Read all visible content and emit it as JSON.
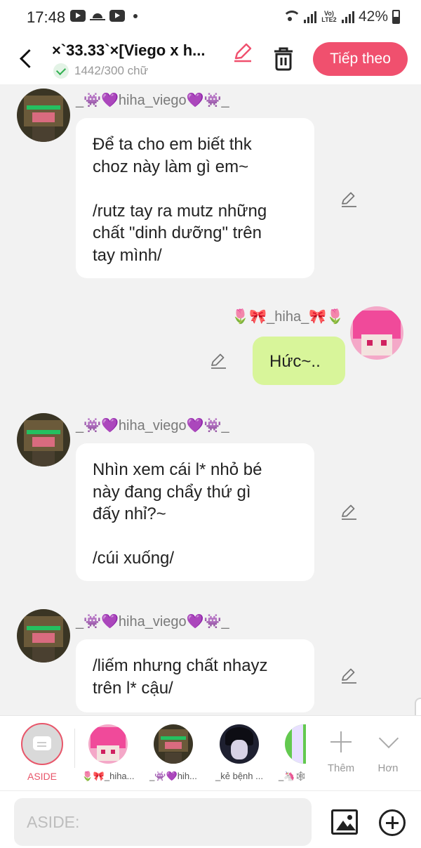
{
  "status_bar": {
    "time": "17:48",
    "network": "Vo) LTE2",
    "battery": "42%"
  },
  "header": {
    "title": "×`33.33`×[Viego x h...",
    "word_count": "1442/300 chữ",
    "next_label": "Tiếp theo",
    "accent_color": "#f0506e"
  },
  "messages": [
    {
      "sender": "_👾💜hiha_viego💜👾_",
      "side": "left",
      "text": "Để ta cho em biết thk\nchoz này làm gì em~\n\n/rutz tay ra mutz những\nchất \"dinh dưỡng\" trên\ntay mình/"
    },
    {
      "sender": "🌷🎀_hiha_🎀🌷",
      "side": "right",
      "text": "Hức~.."
    },
    {
      "sender": "_👾💜hiha_viego💜👾_",
      "side": "left",
      "text": "Nhìn xem cái l* nhỏ bé\nnày đang chẩy thứ gì\nđấy nhỉ?~\n\n/cúi xuống/"
    },
    {
      "sender": "_👾💜hiha_viego💜👾_",
      "side": "left",
      "text": "/liếm nhưng chất nhayz\ntrên l* cậu/"
    }
  ],
  "character_bar": {
    "aside_label": "ASIDE",
    "characters": [
      {
        "label": "🌷🎀_hiha..."
      },
      {
        "label": "_👾💜hih..."
      },
      {
        "label": "_kẻ bệnh ..."
      },
      {
        "label": "_🦄🕸"
      }
    ],
    "add_label": "Thêm",
    "more_label": "Hơn"
  },
  "input": {
    "placeholder": "ASIDE:"
  },
  "colors": {
    "bubble_mine": "#d8f59a",
    "bubble_other": "#ffffff",
    "background": "#f2f2f2"
  }
}
